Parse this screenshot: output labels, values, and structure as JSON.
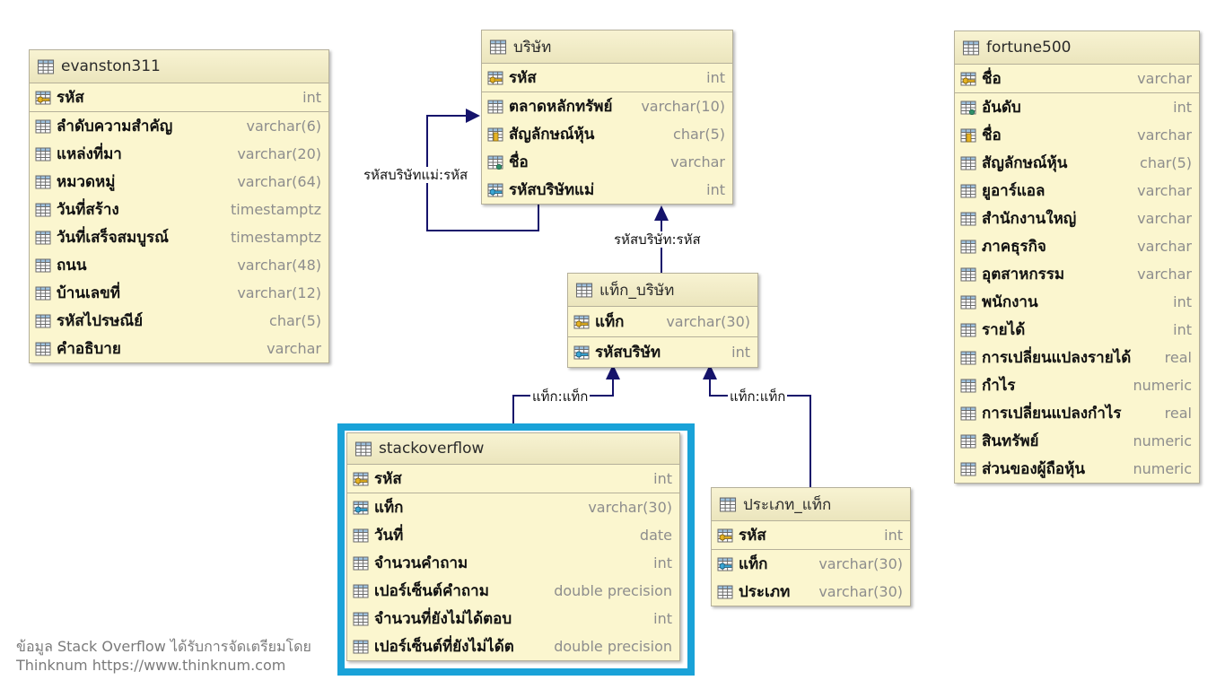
{
  "tables": [
    {
      "id": "evanston311",
      "name": "evanston311",
      "pk": [
        {
          "name": "รหัส",
          "type": "int",
          "icon": "primary-key-icon"
        }
      ],
      "columns": [
        {
          "name": "ลำดับความสำคัญ",
          "type": "varchar(6)",
          "icon": "column-icon"
        },
        {
          "name": "แหล่งที่มา",
          "type": "varchar(20)",
          "icon": "column-icon"
        },
        {
          "name": "หมวดหมู่",
          "type": "varchar(64)",
          "icon": "column-icon"
        },
        {
          "name": "วันที่สร้าง",
          "type": "timestamptz",
          "icon": "column-icon"
        },
        {
          "name": "วันที่เสร็จสมบูรณ์",
          "type": "timestamptz",
          "icon": "column-icon"
        },
        {
          "name": "ถนน",
          "type": "varchar(48)",
          "icon": "column-icon"
        },
        {
          "name": "บ้านเลขที่",
          "type": "varchar(12)",
          "icon": "column-icon"
        },
        {
          "name": "รหัสไปรษณีย์",
          "type": "char(5)",
          "icon": "column-icon"
        },
        {
          "name": "คำอธิบาย",
          "type": "varchar",
          "icon": "column-icon"
        }
      ]
    },
    {
      "id": "company",
      "name": "บริษัท",
      "pk": [
        {
          "name": "รหัส",
          "type": "int",
          "icon": "primary-key-icon"
        }
      ],
      "columns": [
        {
          "name": "ตลาดหลักทรัพย์",
          "type": "varchar(10)",
          "icon": "column-icon"
        },
        {
          "name": "สัญลักษณ์หุ้น",
          "type": "char(5)",
          "icon": "unique-key-icon"
        },
        {
          "name": "ชื่อ",
          "type": "varchar",
          "icon": "not-null-column-icon"
        },
        {
          "name": "รหัสบริษัทแม่",
          "type": "int",
          "icon": "foreign-key-icon"
        }
      ]
    },
    {
      "id": "tag_company",
      "name": "แท็ก_บริษัท",
      "pk": [
        {
          "name": "แท็ก",
          "type": "varchar(30)",
          "icon": "primary-key-icon"
        }
      ],
      "columns": [
        {
          "name": "รหัสบริษัท",
          "type": "int",
          "icon": "foreign-key-icon"
        }
      ]
    },
    {
      "id": "stackoverflow",
      "name": "stackoverflow",
      "pk": [
        {
          "name": "รหัส",
          "type": "int",
          "icon": "primary-key-icon"
        }
      ],
      "columns": [
        {
          "name": "แท็ก",
          "type": "varchar(30)",
          "icon": "foreign-key-icon"
        },
        {
          "name": "วันที่",
          "type": "date",
          "icon": "column-icon"
        },
        {
          "name": "จำนวนคำถาม",
          "type": "int",
          "icon": "column-icon"
        },
        {
          "name": "เปอร์เซ็นต์คำถาม",
          "type": "double precision",
          "icon": "column-icon"
        },
        {
          "name": "จำนวนที่ยังไม่ได้ตอบ",
          "type": "int",
          "icon": "column-icon"
        },
        {
          "name": "เปอร์เซ็นต์ที่ยังไม่ได้ต",
          "type": "double precision",
          "icon": "column-icon"
        }
      ]
    },
    {
      "id": "tag_type",
      "name": "ประเภท_แท็ก",
      "pk": [
        {
          "name": "รหัส",
          "type": "int",
          "icon": "primary-key-icon"
        }
      ],
      "columns": [
        {
          "name": "แท็ก",
          "type": "varchar(30)",
          "icon": "foreign-key-icon"
        },
        {
          "name": "ประเภท",
          "type": "varchar(30)",
          "icon": "column-icon"
        }
      ]
    },
    {
      "id": "fortune500",
      "name": "fortune500",
      "pk": [
        {
          "name": "ชื่อ",
          "type": "varchar",
          "icon": "primary-key-icon"
        }
      ],
      "columns": [
        {
          "name": "อันดับ",
          "type": "int",
          "icon": "not-null-column-icon"
        },
        {
          "name": "ชื่อ",
          "type": "varchar",
          "icon": "unique-key-icon"
        },
        {
          "name": "สัญลักษณ์หุ้น",
          "type": "char(5)",
          "icon": "column-icon"
        },
        {
          "name": "ยูอาร์แอล",
          "type": "varchar",
          "icon": "column-icon"
        },
        {
          "name": "สำนักงานใหญ่",
          "type": "varchar",
          "icon": "column-icon"
        },
        {
          "name": "ภาคธุรกิจ",
          "type": "varchar",
          "icon": "column-icon"
        },
        {
          "name": "อุตสาหกรรม",
          "type": "varchar",
          "icon": "column-icon"
        },
        {
          "name": "พนักงาน",
          "type": "int",
          "icon": "column-icon"
        },
        {
          "name": "รายได้",
          "type": "int",
          "icon": "column-icon"
        },
        {
          "name": "การเปลี่ยนแปลงรายได้",
          "type": "real",
          "icon": "column-icon"
        },
        {
          "name": "กำไร",
          "type": "numeric",
          "icon": "column-icon"
        },
        {
          "name": "การเปลี่ยนแปลงกำไร",
          "type": "real",
          "icon": "column-icon"
        },
        {
          "name": "สินทรัพย์",
          "type": "numeric",
          "icon": "column-icon"
        },
        {
          "name": "ส่วนของผู้ถือหุ้น",
          "type": "numeric",
          "icon": "column-icon"
        }
      ]
    }
  ],
  "relations": [
    {
      "id": "self",
      "from": "company",
      "to": "company",
      "label": "รหัสบริษัทแม่:รหัส"
    },
    {
      "id": "tc",
      "from": "tag_company",
      "to": "company",
      "label": "รหัสบริษัท:รหัส"
    },
    {
      "id": "so",
      "from": "stackoverflow",
      "to": "tag_company",
      "label": "แท็ก:แท็ก"
    },
    {
      "id": "tt",
      "from": "tag_type",
      "to": "tag_company",
      "label": "แท็ก:แท็ก"
    }
  ],
  "highlight": {
    "table": "stackoverflow",
    "color": "#19a2d8"
  },
  "colors": {
    "table_bg": "#fbf6cf",
    "border": "#b5b09a",
    "connector": "#15136b"
  },
  "credit": {
    "line1": "ข้อมูล Stack Overflow ได้รับการจัดเตรียมโดย",
    "line2": "Thinknum https://www.thinknum.com"
  }
}
